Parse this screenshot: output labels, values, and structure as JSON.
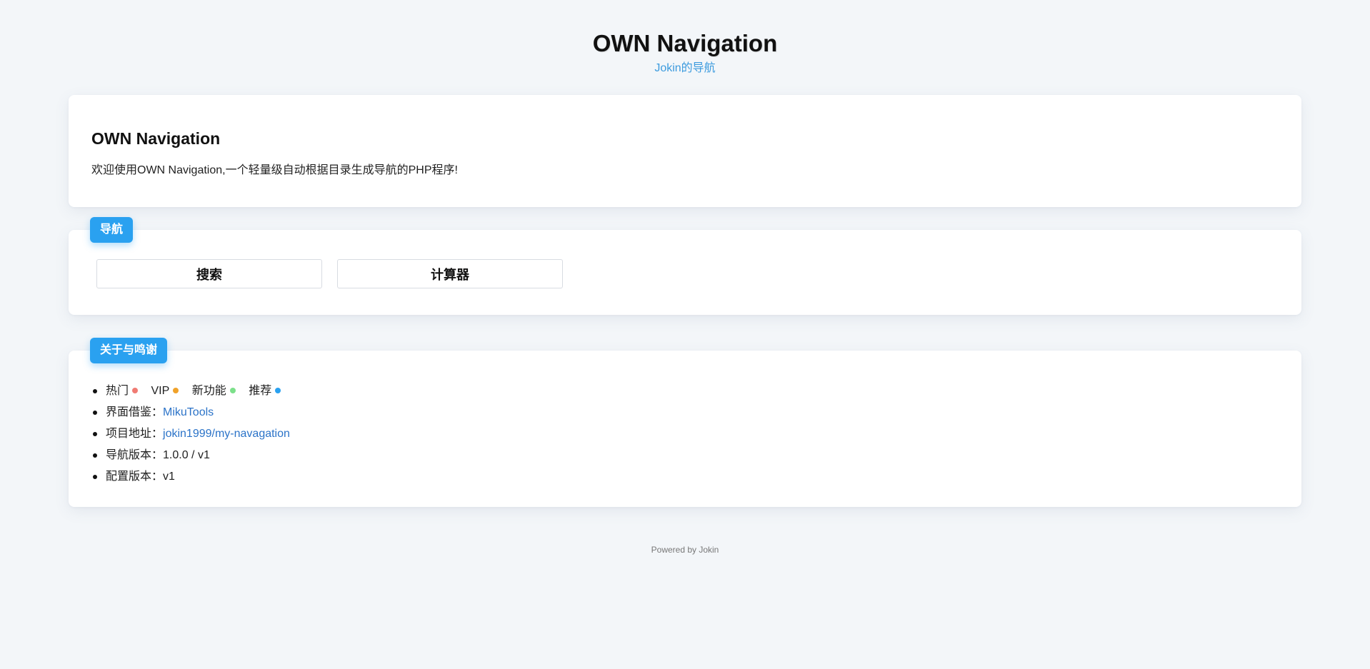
{
  "header": {
    "title": "OWN Navigation",
    "subtitle": "Jokin的导航"
  },
  "intro": {
    "title": "OWN Navigation",
    "text": "欢迎使用OWN Navigation,一个轻量级自动根据目录生成导航的PHP程序!"
  },
  "nav_section": {
    "label": "导航",
    "buttons": [
      {
        "label": "搜索"
      },
      {
        "label": "计算器"
      }
    ]
  },
  "about_section": {
    "label": "关于与鸣谢",
    "legend": [
      {
        "label": "热门",
        "color": "#f07b73"
      },
      {
        "label": "VIP",
        "color": "#f0a22a"
      },
      {
        "label": "新功能",
        "color": "#7ce08a"
      },
      {
        "label": "推荐",
        "color": "#2aa1f0"
      }
    ],
    "ui_ref_label": "界面借鉴：",
    "ui_ref_link": "MikuTools",
    "project_label": "项目地址：",
    "project_link": "jokin1999/my-navagation",
    "nav_version_label": "导航版本：",
    "nav_version": "1.0.0 / v1",
    "config_version_label": "配置版本：",
    "config_version": "v1"
  },
  "footer": {
    "text": "Powered by Jokin"
  },
  "colors": {
    "background": "#f3f6f9",
    "accent": "#2aa1f0",
    "link": "#2b73c8",
    "subtitle": "#3c9bde"
  }
}
